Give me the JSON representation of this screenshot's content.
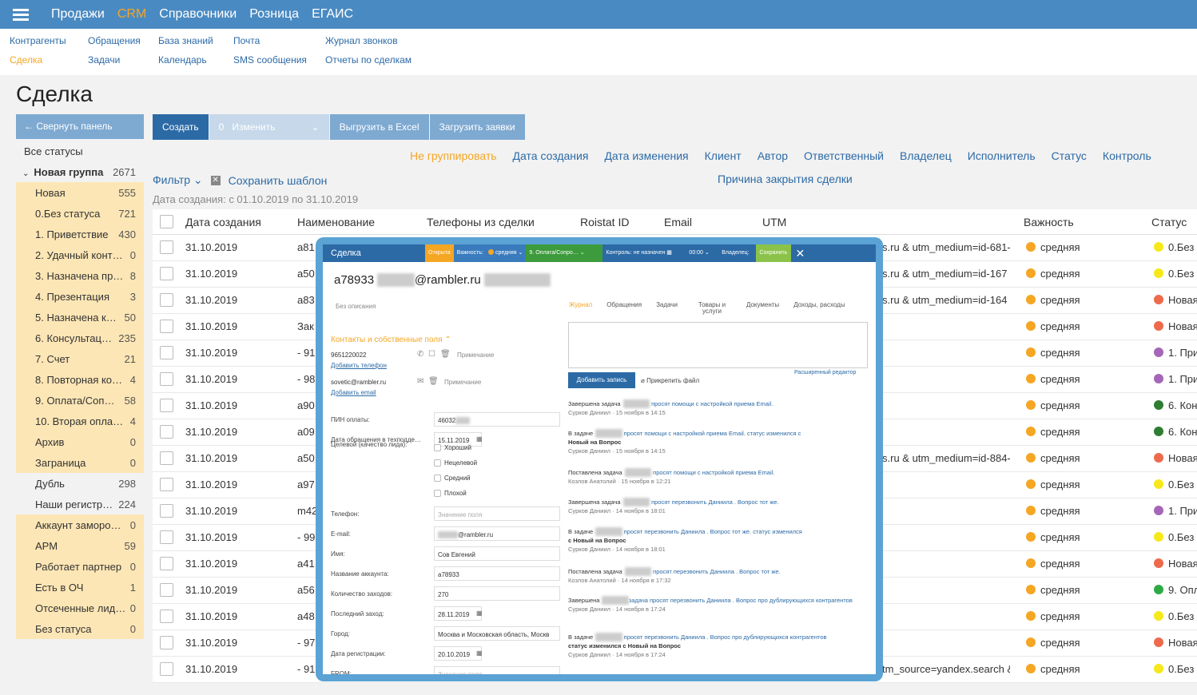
{
  "topnav": {
    "items": [
      "Продажи",
      "CRM",
      "Справочники",
      "Розница",
      "ЕГАИС"
    ]
  },
  "subnav": {
    "col1": [
      "Контрагенты",
      "Сделка"
    ],
    "col2": [
      "Обращения",
      "Задачи"
    ],
    "col3": [
      "База знаний",
      "Календарь"
    ],
    "col4": [
      "Почта",
      "SMS сообщения"
    ],
    "col5": [
      "Журнал звонков",
      "Отчеты по сделкам"
    ]
  },
  "page_title": "Сделка",
  "sidebar": {
    "collapse": "← Свернуть панель",
    "all": "Все статусы",
    "group": {
      "label": "Новая группа",
      "count": "2671"
    },
    "items": [
      {
        "label": "Новая",
        "count": "555",
        "hl": true
      },
      {
        "label": "0.Без статуса",
        "count": "721",
        "hl": true
      },
      {
        "label": "1. Приветствие",
        "count": "430",
        "hl": true
      },
      {
        "label": "2. Удачный конт…",
        "count": "0",
        "hl": true
      },
      {
        "label": "3. Назначена пр…",
        "count": "8",
        "hl": true
      },
      {
        "label": "4. Презентация",
        "count": "3",
        "hl": true
      },
      {
        "label": "5. Назначена к…",
        "count": "50",
        "hl": true
      },
      {
        "label": "6. Консультац…",
        "count": "235",
        "hl": true
      },
      {
        "label": "7. Счет",
        "count": "21",
        "hl": true
      },
      {
        "label": "8. Повторная ко…",
        "count": "4",
        "hl": true
      },
      {
        "label": "9. Оплата/Соп…",
        "count": "58",
        "hl": true
      },
      {
        "label": "10. Вторая опла…",
        "count": "4",
        "hl": true
      },
      {
        "label": "Архив",
        "count": "0",
        "hl": true
      },
      {
        "label": "Заграница",
        "count": "0",
        "hl": true
      },
      {
        "label": "Дубль",
        "count": "298",
        "hl": false
      },
      {
        "label": "Наши регистр…",
        "count": "224",
        "hl": false
      },
      {
        "label": "Аккаунт заморо…",
        "count": "0",
        "hl": true
      },
      {
        "label": "АРМ",
        "count": "59",
        "hl": true
      },
      {
        "label": "Работает партнер",
        "count": "0",
        "hl": true
      },
      {
        "label": "Есть в ОЧ",
        "count": "1",
        "hl": true
      },
      {
        "label": "Отсеченные лид…",
        "count": "0",
        "hl": true
      },
      {
        "label": "Без статуса",
        "count": "0",
        "hl": true
      }
    ]
  },
  "toolbar": {
    "create": "Создать",
    "edit": "Изменить",
    "edit_count": "0",
    "excel": "Выгрузить в Excel",
    "upload": "Загрузить заявки"
  },
  "groupby": [
    "Не группировать",
    "Дата создания",
    "Дата изменения",
    "Клиент",
    "Автор",
    "Ответственный",
    "Владелец",
    "Исполнитель",
    "Статус",
    "Контроль"
  ],
  "groupby_reason": "Причина закрытия сделки",
  "filter": {
    "label": "Фильтр",
    "save": "Сохранить шаблон",
    "range": "Дата создания: с 01.10.2019 по 31.10.2019"
  },
  "table": {
    "headers": [
      "Дата создания",
      "Наименование",
      "Телефоны из сделки",
      "Roistat ID",
      "Email",
      "UTM",
      "Важность",
      "Статус"
    ],
    "rows": [
      {
        "date": "31.10.2019",
        "name": "a81",
        "utm": "s.ru  & utm_medium=id-681-",
        "imp": "средняя",
        "status": "0.Без",
        "sc": "#f6e81a"
      },
      {
        "date": "31.10.2019",
        "name": "a50",
        "utm": "s.ru  & utm_medium=id-167",
        "imp": "средняя",
        "status": "0.Без",
        "sc": "#f6e81a"
      },
      {
        "date": "31.10.2019",
        "name": "a83",
        "utm": "s.ru  & utm_medium=id-164",
        "imp": "средняя",
        "status": "Новая",
        "sc": "#ee6a4c"
      },
      {
        "date": "31.10.2019",
        "name": "Зак",
        "utm": "",
        "imp": "средняя",
        "status": "Новая",
        "sc": "#ee6a4c"
      },
      {
        "date": "31.10.2019",
        "name": "- 91",
        "utm": "",
        "imp": "средняя",
        "status": "1. При",
        "sc": "#a566b8"
      },
      {
        "date": "31.10.2019",
        "name": "- 98",
        "utm": "",
        "imp": "средняя",
        "status": "1. При",
        "sc": "#a566b8"
      },
      {
        "date": "31.10.2019",
        "name": "a90",
        "utm": "",
        "imp": "средняя",
        "status": "6. Кон",
        "sc": "#2e7d32"
      },
      {
        "date": "31.10.2019",
        "name": "a09",
        "utm": "",
        "imp": "средняя",
        "status": "6. Кон",
        "sc": "#2e7d32"
      },
      {
        "date": "31.10.2019",
        "name": "a50",
        "utm": "s.ru  & utm_medium=id-884-",
        "imp": "средняя",
        "status": "Новая",
        "sc": "#ee6a4c"
      },
      {
        "date": "31.10.2019",
        "name": "a97",
        "utm": "",
        "imp": "средняя",
        "status": "0.Без",
        "sc": "#f6e81a"
      },
      {
        "date": "31.10.2019",
        "name": "m42",
        "utm": "",
        "imp": "средняя",
        "status": "1. При",
        "sc": "#a566b8"
      },
      {
        "date": "31.10.2019",
        "name": "- 99",
        "utm": "",
        "imp": "средняя",
        "status": "0.Без",
        "sc": "#f6e81a"
      },
      {
        "date": "31.10.2019",
        "name": "a41",
        "utm": "",
        "imp": "средняя",
        "status": "Новая",
        "sc": "#ee6a4c"
      },
      {
        "date": "31.10.2019",
        "name": "a56",
        "utm": "",
        "imp": "средняя",
        "status": "9. Опл",
        "sc": "#2eaa44"
      },
      {
        "date": "31.10.2019",
        "name": "a48",
        "utm": "",
        "imp": "средняя",
        "status": "0.Без",
        "sc": "#f6e81a"
      },
      {
        "date": "31.10.2019",
        "name": "- 97",
        "utm": "",
        "imp": "средняя",
        "status": "Новая",
        "sc": "#ee6a4c"
      },
      {
        "date": "31.10.2019",
        "name": "- 91",
        "utm": "tm_source=yandex.search  &",
        "imp": "средняя",
        "status": "0.Без",
        "sc": "#f6e81a"
      }
    ]
  },
  "modal": {
    "header": {
      "title": "Сделка",
      "state": "Открыта",
      "importance": "Важность:",
      "importance_val": "средняя",
      "stage": "9. Оплата/Сопро…",
      "control": "Контроль: не назначен",
      "time": "00:00",
      "owner_line1": "Владелец:",
      "owner_line2": "Сурков Даниил",
      "save": "Сохранить",
      "close": "✕"
    },
    "title": "a78933",
    "title_email": "@rambler.ru",
    "no_desc": "Без описания",
    "contacts_heading": "Контакты и собственные поля",
    "phone": "9651220022",
    "add_phone": "Добавить телефон",
    "note": "Примечание",
    "email": "sovetic@rambler.ru",
    "add_email": "Добавить email",
    "fields": [
      {
        "label": "ПИН оплаты:",
        "value": "46032",
        "ph": false
      },
      {
        "label": "Дата обращения в техподде…",
        "value": "15.11.2019",
        "ph": false
      },
      {
        "label": "Телефон:",
        "value": "Значение поля",
        "ph": true
      },
      {
        "label": "E-mail:",
        "value": "@rambler.ru",
        "ph": false
      },
      {
        "label": "Имя:",
        "value": "Сов Евгений",
        "ph": false
      },
      {
        "label": "Название аккаунта:",
        "value": "a78933",
        "ph": false
      },
      {
        "label": "Количество заходов:",
        "value": "270",
        "ph": false
      },
      {
        "label": "Последний заход:",
        "value": "28.11.2019",
        "ph": false
      },
      {
        "label": "Город:",
        "value": "Москва и Московская область, Москв",
        "ph": false
      },
      {
        "label": "Дата регистрации:",
        "value": "20.10.2019",
        "ph": false
      },
      {
        "label": "FROM:",
        "value": "Значение поля",
        "ph": true
      }
    ],
    "target_label": "Целевой (качество лида):",
    "target_opts": [
      "Хороший",
      "Нецелевой",
      "Средний",
      "Плохой"
    ],
    "tabs": [
      "Журнал",
      "Обращения",
      "Задачи",
      "Товары и услуги",
      "Документы",
      "Доходы, расходы"
    ],
    "rich_editor": "Расширенный редактор",
    "add_record": "Добавить запись",
    "attach": "Прикрепить файл",
    "log": [
      {
        "l1": "Завершена задача",
        "l2": " просят помощи с настройкой приема Email.",
        "meta": "Сурков Даниил · 15 ноября в 14:15"
      },
      {
        "l1": "В задаче",
        "l2": " просят помощи с настройкой приема Email. статус изменился с",
        "l3": "Новый на Вопрос",
        "meta": "Сурков Даниил · 15 ноября в 14:15"
      },
      {
        "l1": "Поставлена задача",
        "l2": " просят помощи с настройкой приема Email.",
        "meta": "Козлов Анатолий · 15 ноября в 12:21"
      },
      {
        "l1": "Завершена задача",
        "l2": " просят перезвонить Даниила . Вопрос тот же.",
        "meta": "Сурков Даниил · 14 ноября в 18:01"
      },
      {
        "l1": "В задаче",
        "l2": " просят перезвонить Даниила . Вопрос тот же. статус изменился",
        "l3": "с Новый на Вопрос",
        "meta": "Сурков Даниил · 14 ноября в 18:01"
      },
      {
        "l1": "Поставлена задача",
        "l2": " просят перезвонить Даниила . Вопрос тот же.",
        "meta": "Козлов Анатолий · 14 ноября в 17:32"
      },
      {
        "l1": "Завершена",
        "l2": "задача  просят перезвонить Даниила . Вопрос про дублирующихся контрагентов",
        "meta": "Сурков Даниил · 14 ноября в 17:24"
      },
      {
        "l1": "В задаче",
        "l2": " просят перезвонить Даниила . Вопрос про дублирующихся контрагентов",
        "l3": "статус изменился с Новый на Вопрос",
        "meta": "Сурков Даниил · 14 ноября в 17:24"
      }
    ]
  },
  "colors": {
    "accent": "#4a8ac2",
    "highlight": "#fde6b5",
    "orange": "#f5a623"
  }
}
